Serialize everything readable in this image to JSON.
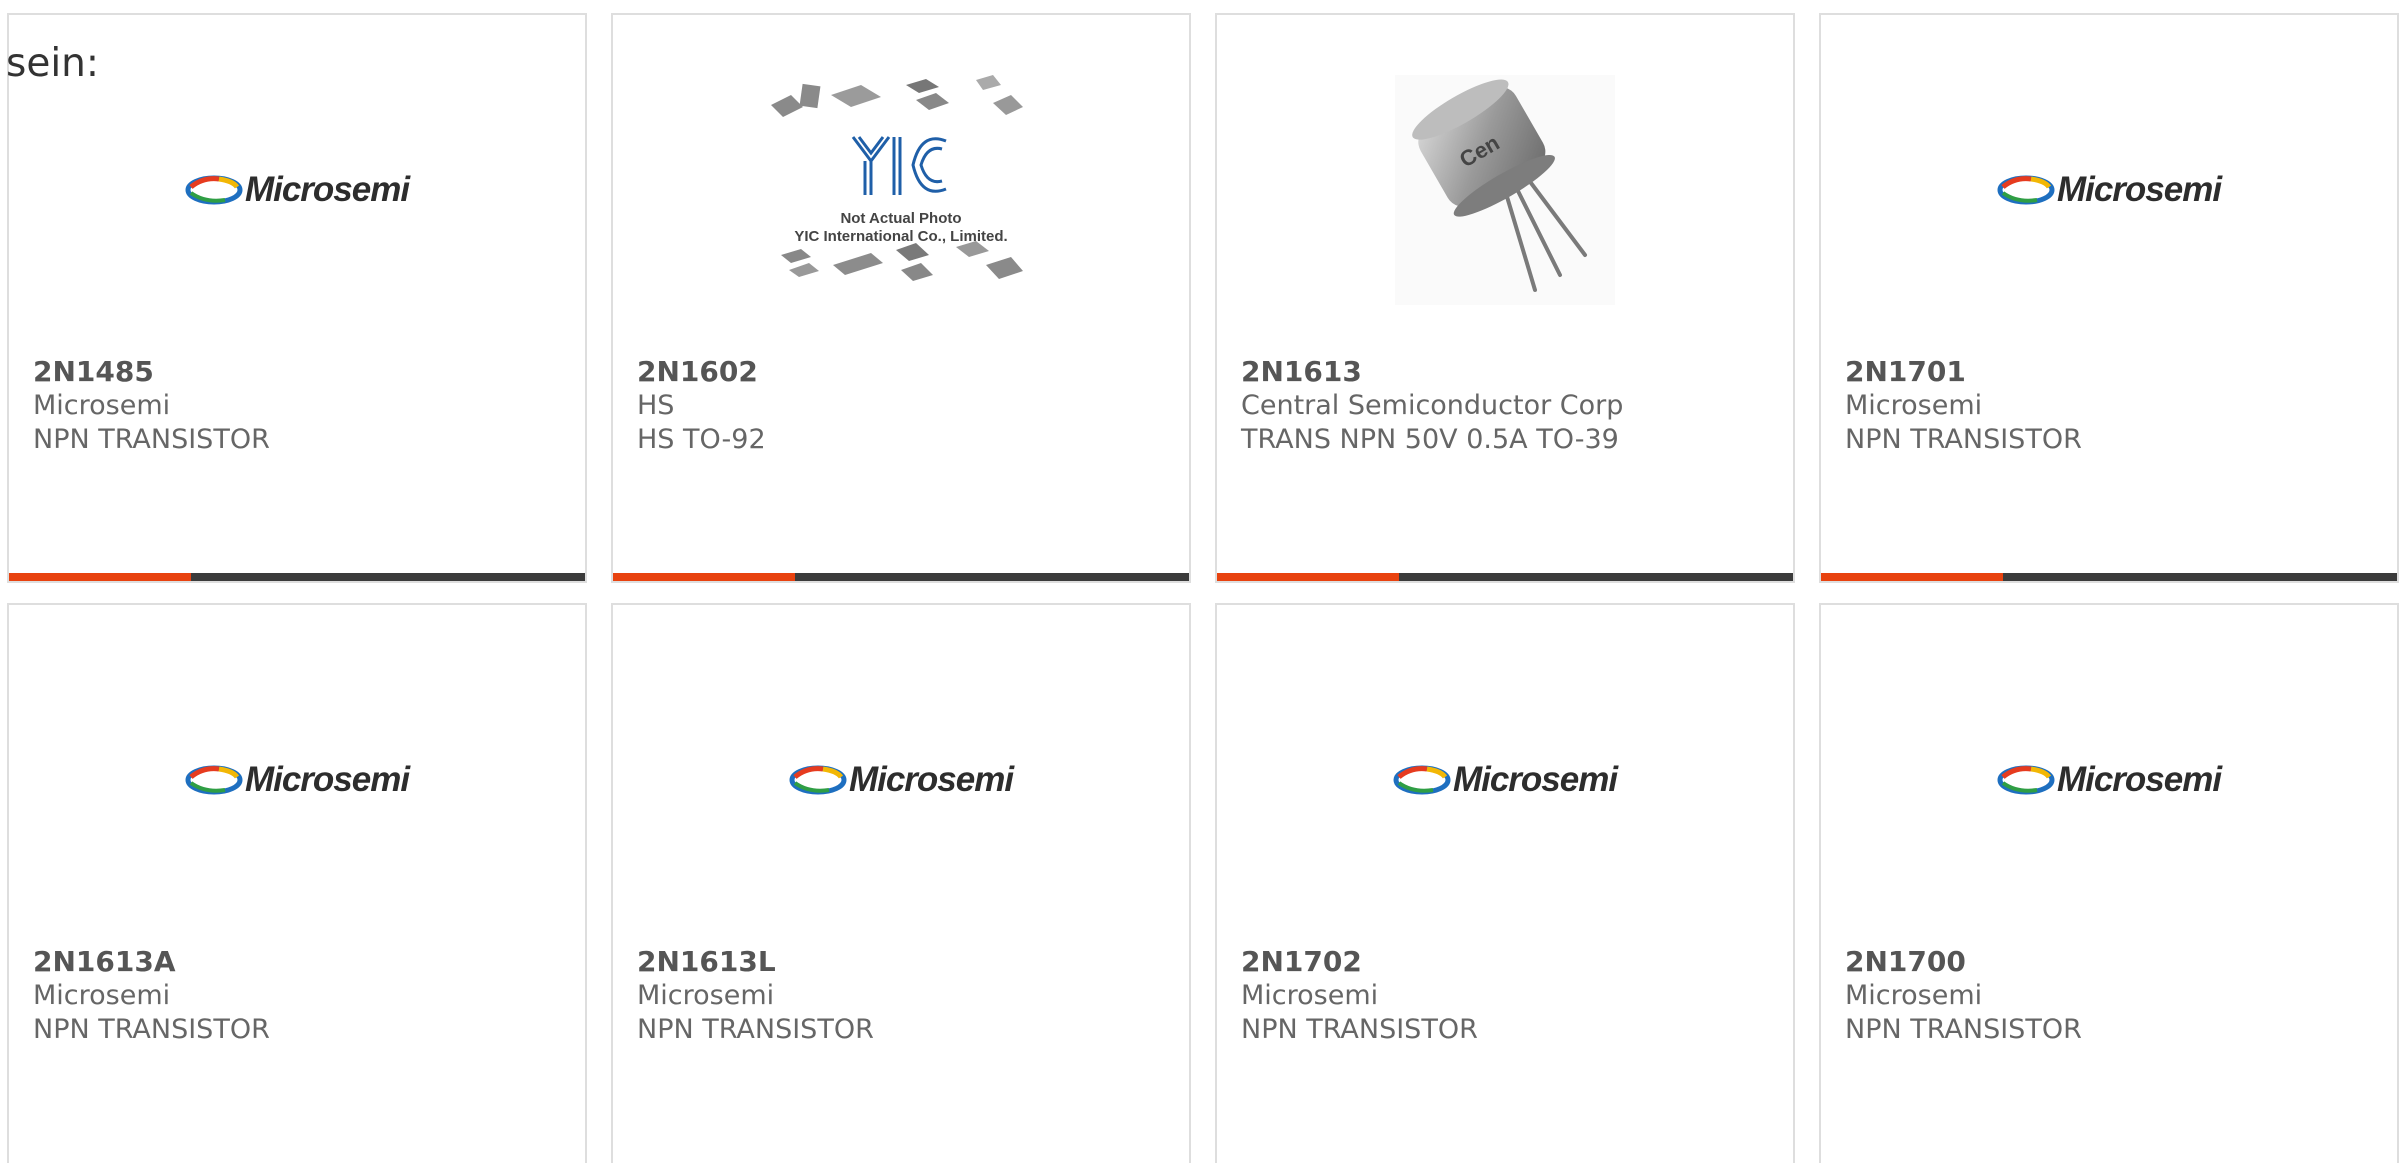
{
  "leading_text": "sein:",
  "colors": {
    "accent": "#e8420f",
    "bar": "#3b3b3b",
    "border": "#dedede",
    "part_text": "#555555",
    "meta_text": "#666666"
  },
  "logo": {
    "brand": "Microsemi",
    "icon": "microsemi-logo"
  },
  "placeholder": {
    "brand": "YIC",
    "caption_line1": "Not Actual Photo",
    "caption_line2": "YIC International Co., Limited."
  },
  "products": [
    {
      "part": "2N1485",
      "manufacturer": "Microsemi",
      "description": "NPN TRANSISTOR",
      "image": "microsemi-logo"
    },
    {
      "part": "2N1602",
      "manufacturer": "HS",
      "description": "HS TO-92",
      "image": "yic-placeholder"
    },
    {
      "part": "2N1613",
      "manufacturer": "Central Semiconductor Corp",
      "description": "TRANS NPN 50V 0.5A TO-39",
      "image": "to39-transistor-photo"
    },
    {
      "part": "2N1701",
      "manufacturer": "Microsemi",
      "description": "NPN TRANSISTOR",
      "image": "microsemi-logo"
    },
    {
      "part": "2N1613A",
      "manufacturer": "Microsemi",
      "description": "NPN TRANSISTOR",
      "image": "microsemi-logo"
    },
    {
      "part": "2N1613L",
      "manufacturer": "Microsemi",
      "description": "NPN TRANSISTOR",
      "image": "microsemi-logo"
    },
    {
      "part": "2N1702",
      "manufacturer": "Microsemi",
      "description": "NPN TRANSISTOR",
      "image": "microsemi-logo"
    },
    {
      "part": "2N1700",
      "manufacturer": "Microsemi",
      "description": "NPN TRANSISTOR",
      "image": "microsemi-logo"
    }
  ]
}
